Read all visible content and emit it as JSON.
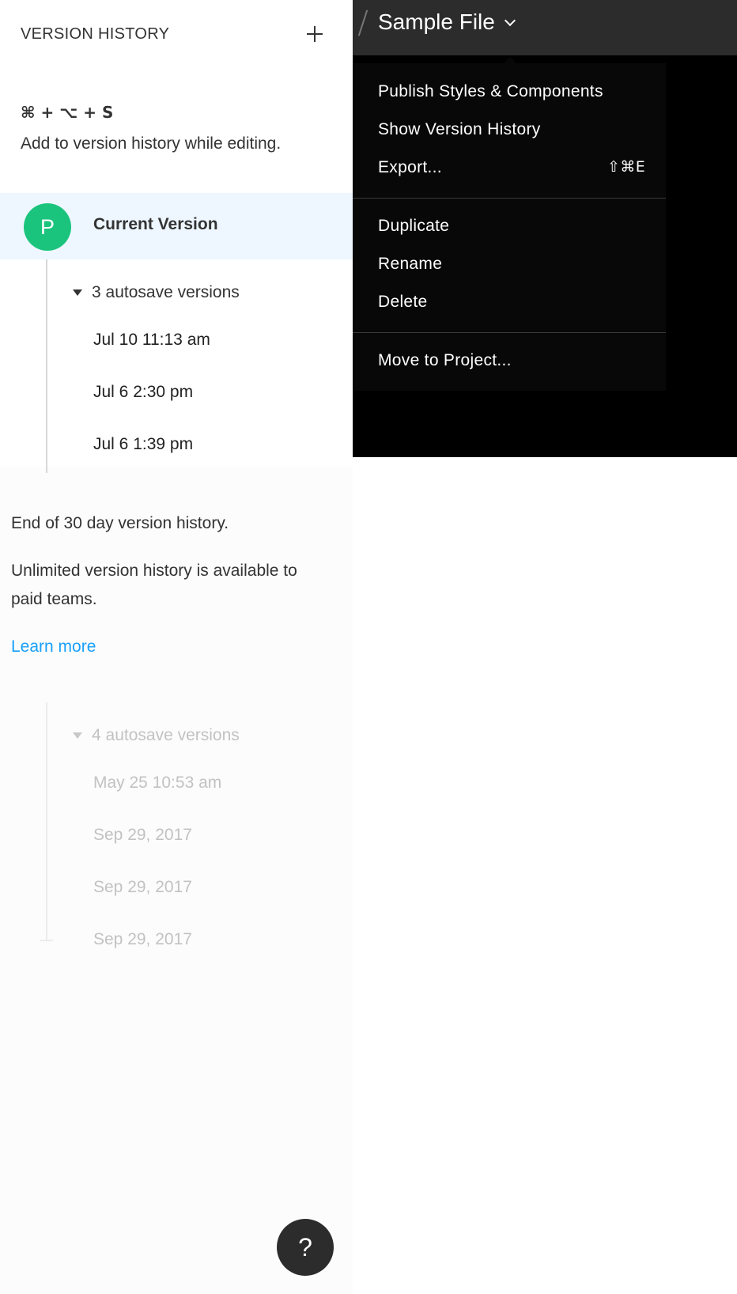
{
  "panel": {
    "title": "VERSION HISTORY",
    "shortcut": "⌘ + ⌥ + S",
    "hint": "Add to version history while editing.",
    "current_version": {
      "avatar_letter": "P",
      "label": "Current Version"
    },
    "recent_group": {
      "toggle_label": "3 autosave versions",
      "items": [
        "Jul 10 11:13 am",
        "Jul 6 2:30 pm",
        "Jul 6 1:39 pm"
      ]
    },
    "end_note": "End of 30 day version history.",
    "upsell_note": "Unlimited version history is available to paid teams.",
    "learn_more": "Learn more",
    "older_group": {
      "toggle_label": "4 autosave versions",
      "items": [
        "May 25 10:53 am",
        "Sep 29, 2017",
        "Sep 29, 2017",
        "Sep 29, 2017"
      ]
    },
    "help_label": "?"
  },
  "header": {
    "file_name": "Sample File"
  },
  "menu": {
    "items": [
      {
        "label": "Publish Styles & Components",
        "shortcut": ""
      },
      {
        "label": "Show Version History",
        "shortcut": ""
      },
      {
        "label": "Export...",
        "shortcut": "⇧⌘E"
      },
      {
        "label": "Duplicate",
        "shortcut": ""
      },
      {
        "label": "Rename",
        "shortcut": ""
      },
      {
        "label": "Delete",
        "shortcut": ""
      },
      {
        "label": "Move to Project...",
        "shortcut": ""
      }
    ]
  },
  "colors": {
    "avatar": "#1bc47d",
    "link": "#18a0fb",
    "current_row_bg": "#eef7ff",
    "menu_bg": "#080808",
    "topbar_bg": "#2c2c2c"
  }
}
